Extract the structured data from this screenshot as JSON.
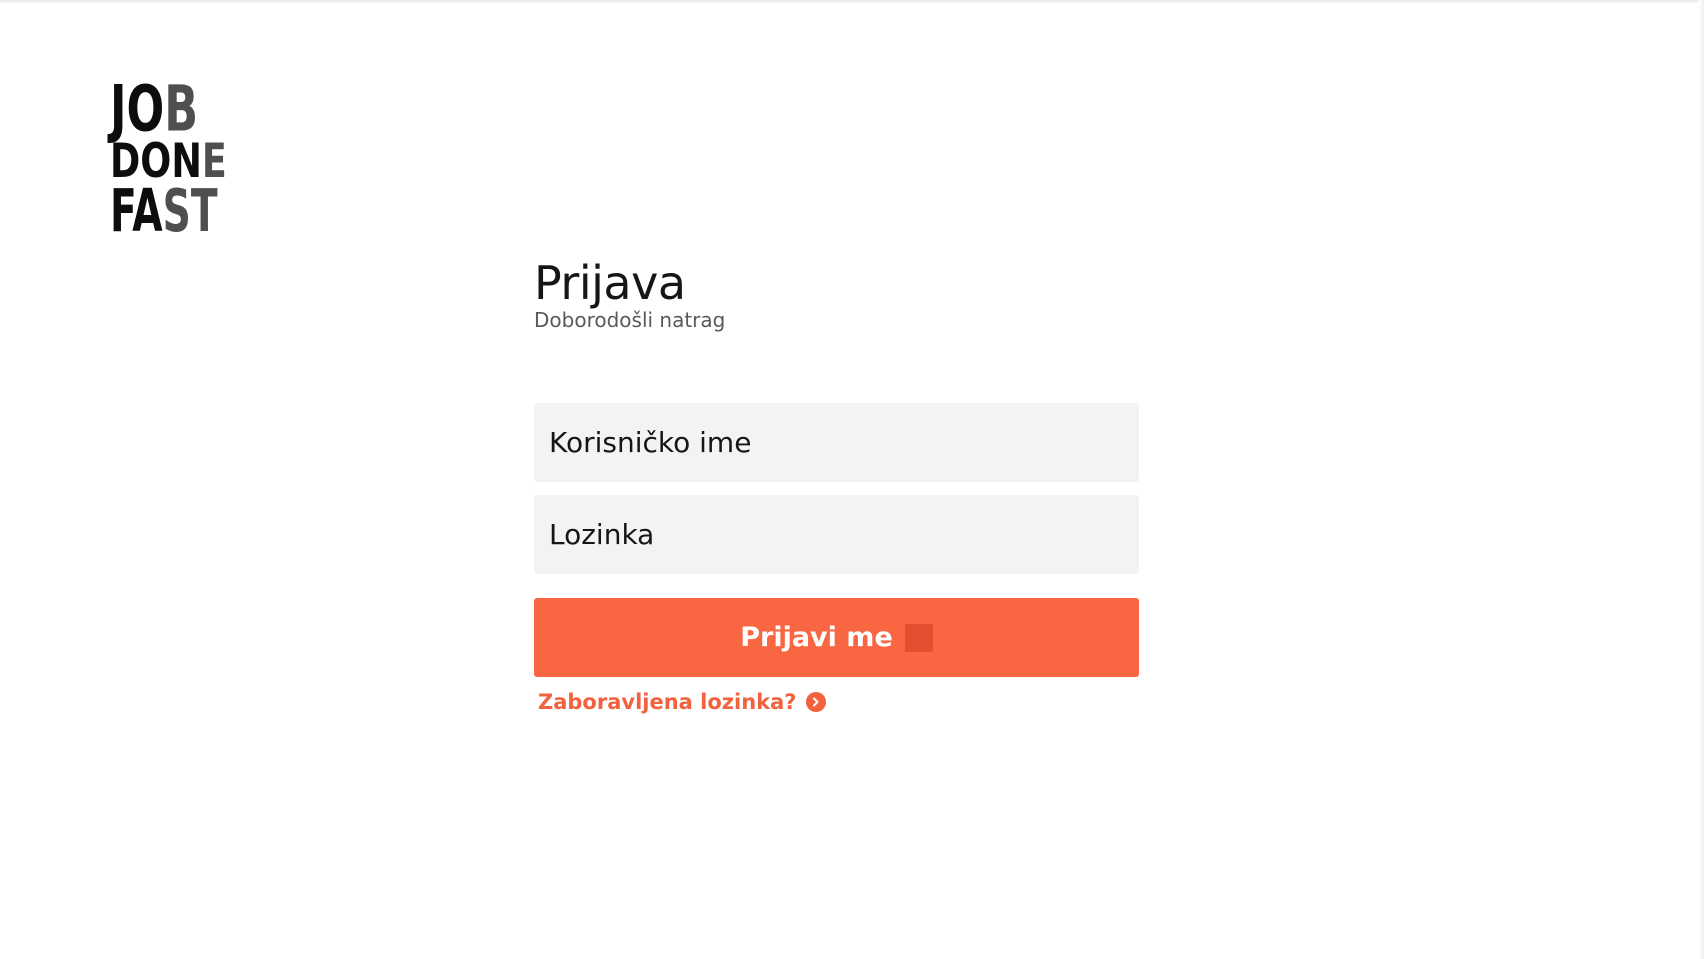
{
  "logo": {
    "row1_a": "JO",
    "row1_b": "B",
    "row2_a": "DON",
    "row2_b": "E",
    "row3_a": "FA",
    "row3_b": "ST"
  },
  "login": {
    "title": "Prijava",
    "subtitle": "Doborodošli natrag",
    "username_placeholder": "Korisničko ime",
    "password_placeholder": "Lozinka",
    "submit_label": "Prijavi me",
    "forgot_label": "Zaboravljena lozinka?"
  },
  "colors": {
    "accent": "#f86642",
    "link": "#f2623e",
    "field_bg": "#f3f3f3"
  },
  "icons": {
    "submit": "arrow-right-icon",
    "forgot": "chevron-right-circle-icon"
  }
}
